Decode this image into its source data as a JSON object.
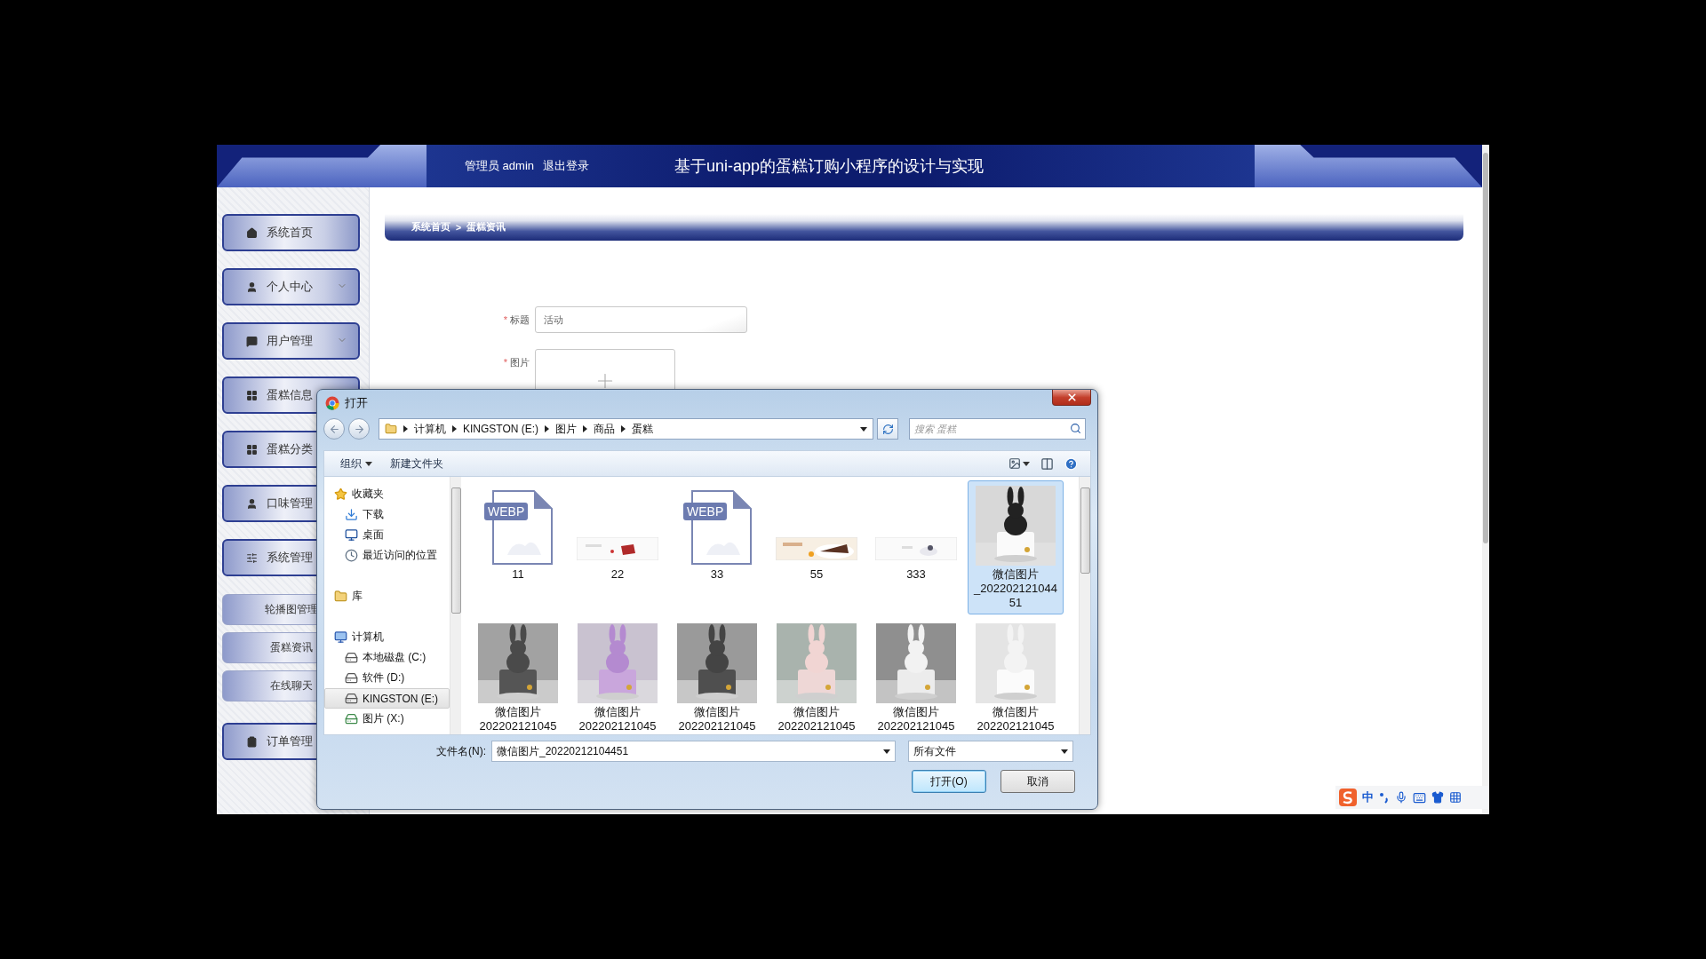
{
  "header": {
    "user": "管理员 admin",
    "logout": "退出登录",
    "title": "基于uni-app的蛋糕订购小程序的设计与实现"
  },
  "sidebar": {
    "items": [
      {
        "kind": "menu",
        "label": "系统首页"
      },
      {
        "kind": "menu",
        "label": "个人中心",
        "expanded": false
      },
      {
        "kind": "menu",
        "label": "用户管理",
        "expanded": false
      },
      {
        "kind": "menu",
        "label": "蛋糕信息"
      },
      {
        "kind": "menu",
        "label": "蛋糕分类"
      },
      {
        "kind": "menu",
        "label": "口味管理"
      },
      {
        "kind": "menu",
        "label": "系统管理"
      },
      {
        "kind": "submenu",
        "label": "轮播图管理"
      },
      {
        "kind": "submenu",
        "label": "蛋糕资讯"
      },
      {
        "kind": "submenu",
        "label": "在线聊天"
      },
      {
        "kind": "menu",
        "label": "订单管理"
      }
    ]
  },
  "breadcrumb": {
    "items": [
      "系统首页",
      "蛋糕资讯"
    ],
    "separator": ">"
  },
  "form": {
    "fields": [
      {
        "kind": "text",
        "mark": "*",
        "label": "标题",
        "value": "活动"
      },
      {
        "kind": "upload",
        "mark": "*",
        "label": "图片"
      }
    ]
  },
  "dialog": {
    "title": "打开",
    "path": [
      "计算机",
      "KINGSTON (E:)",
      "图片",
      "商品",
      "蛋糕"
    ],
    "search": {
      "placeholder": "搜索 蛋糕"
    },
    "toolbar": [
      {
        "label": "组织",
        "menu": true
      },
      {
        "label": "新建文件夹",
        "menu": false
      }
    ],
    "nav": [
      {
        "label": "收藏夹",
        "selected": false,
        "children": [
          {
            "label": "下载",
            "selected": false
          },
          {
            "label": "桌面",
            "selected": false
          },
          {
            "label": "最近访问的位置",
            "selected": false
          }
        ]
      },
      {
        "label": "库",
        "selected": false
      },
      {
        "label": "计算机",
        "selected": false,
        "children": [
          {
            "label": "本地磁盘 (C:)",
            "selected": false
          },
          {
            "label": "软件 (D:)",
            "selected": false
          },
          {
            "label": "KINGSTON (E:)",
            "selected": true
          },
          {
            "label": "图片 (X:)",
            "selected": false
          }
        ]
      }
    ],
    "files": [
      {
        "kind": "webp",
        "badge": "WEBP",
        "name_lines": [
          "11"
        ],
        "selected": false
      },
      {
        "kind": "banner",
        "name_lines": [
          "22"
        ],
        "selected": false
      },
      {
        "kind": "webp",
        "badge": "WEBP",
        "name_lines": [
          "33"
        ],
        "selected": false
      },
      {
        "kind": "banner",
        "name_lines": [
          "55"
        ],
        "selected": false
      },
      {
        "kind": "banner",
        "name_lines": [
          "333"
        ],
        "selected": false
      },
      {
        "name_lines": [
          "微信图片",
          "_202202121044",
          "51"
        ],
        "selected": true
      },
      {
        "name_lines": [
          "微信图片",
          "202202121045"
        ],
        "selected": false
      },
      {
        "name_lines": [
          "微信图片",
          "202202121045"
        ],
        "selected": false
      },
      {
        "name_lines": [
          "微信图片",
          "202202121045"
        ],
        "selected": false
      },
      {
        "name_lines": [
          "微信图片",
          "202202121045"
        ],
        "selected": false
      },
      {
        "name_lines": [
          "微信图片",
          "202202121045"
        ],
        "selected": false
      },
      {
        "name_lines": [
          "微信图片",
          "202202121045"
        ],
        "selected": false
      }
    ],
    "file_name": {
      "label": "文件名(N):",
      "value": "微信图片_20220212104451"
    },
    "file_type": {
      "value": "所有文件"
    },
    "buttons": [
      {
        "label": "打开(O)",
        "focused": true
      },
      {
        "label": "取消",
        "focused": false
      }
    ]
  },
  "ime": {
    "mode": "中"
  }
}
